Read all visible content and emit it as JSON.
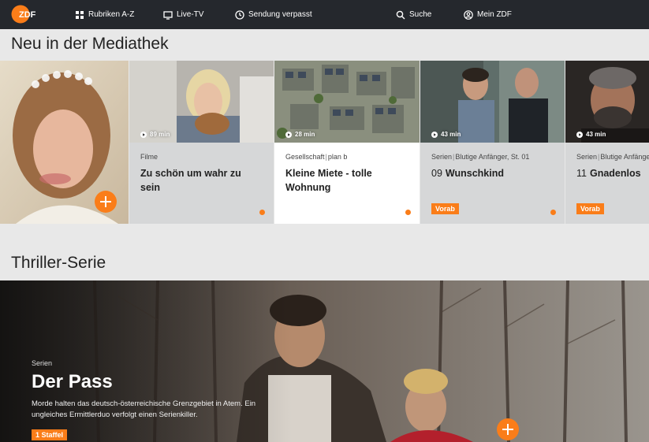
{
  "nav": {
    "logo_text": "ZDF",
    "rubriken": "Rubriken A-Z",
    "livetv": "Live-TV",
    "verpasst": "Sendung verpasst",
    "suche": "Suche",
    "meinzdf": "Mein ZDF",
    "icons": [
      "grid-icon",
      "tv-icon",
      "clock-icon",
      "search-icon",
      "user-icon"
    ]
  },
  "section1": {
    "title": "Neu in der Mediathek"
  },
  "cards": [
    {
      "duration": "89 min",
      "genre": "Filme",
      "title": "Zu schön um wahr zu sein"
    },
    {
      "duration": "28 min",
      "genre": "Gesellschaft",
      "subgenre": "plan b",
      "title": "Kleine Miete - tolle Wohnung"
    },
    {
      "duration": "43 min",
      "genre": "Serien",
      "subgenre": "Blutige Anfänger, St. 01",
      "episode": "09",
      "title": "Wunschkind",
      "badge": "Vorab"
    },
    {
      "duration": "43 min",
      "genre": "Serien",
      "subgenre": "Blutige Anfänger",
      "episode": "11",
      "title": "Gnadenlos",
      "badge": "Vorab"
    }
  ],
  "section2": {
    "title": "Thriller-Serie"
  },
  "hero": {
    "genre": "Serien",
    "title": "Der Pass",
    "description": "Morde halten das deutsch-österreichische Grenzgebiet in Atem. Ein ungleiches Ermittlerduo verfolgt einen Serienkiller.",
    "badge": "1 Staffel"
  },
  "colors": {
    "accent": "#fa7d19",
    "nav_bg": "#25282d",
    "page_bg": "#e8e8e8"
  }
}
